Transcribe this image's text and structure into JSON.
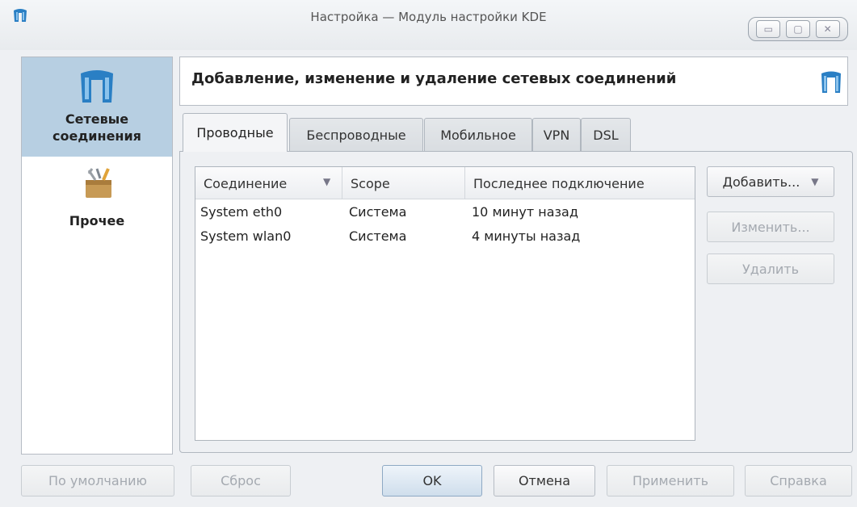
{
  "window": {
    "title": "Настройка — Модуль настройки KDE",
    "controls": [
      "minimize-icon",
      "maximize-icon",
      "close-icon"
    ]
  },
  "sidebar": {
    "items": [
      {
        "label_line1": "Сетевые",
        "label_line2": "соединения",
        "icon": "network-icon",
        "selected": true
      },
      {
        "label": "Прочее",
        "icon": "tools-icon",
        "selected": false
      }
    ]
  },
  "header": {
    "title": "Добавление, изменение и удаление сетевых соединений",
    "icon": "network-icon"
  },
  "tabs": [
    {
      "label": "Проводные",
      "active": true
    },
    {
      "label": "Беспроводные",
      "active": false
    },
    {
      "label": "Мобильное",
      "active": false
    },
    {
      "label": "VPN",
      "active": false
    },
    {
      "label": "DSL",
      "active": false
    }
  ],
  "table": {
    "columns": [
      "Соединение",
      "Scope",
      "Последнее подключение"
    ],
    "rows": [
      {
        "connection": "System eth0",
        "scope": "Система",
        "last": "10 минут назад"
      },
      {
        "connection": "System wlan0",
        "scope": "Система",
        "last": "4 минуты назад"
      }
    ]
  },
  "actions": {
    "add": "Добавить...",
    "edit": "Изменить...",
    "delete": "Удалить"
  },
  "footer": {
    "defaults": "По умолчанию",
    "reset": "Сброс",
    "ok": "OK",
    "cancel": "Отмена",
    "apply": "Применить",
    "help": "Справка"
  },
  "colors": {
    "selection": "#b7cfe2",
    "network_icon": "#2a7fc4"
  }
}
